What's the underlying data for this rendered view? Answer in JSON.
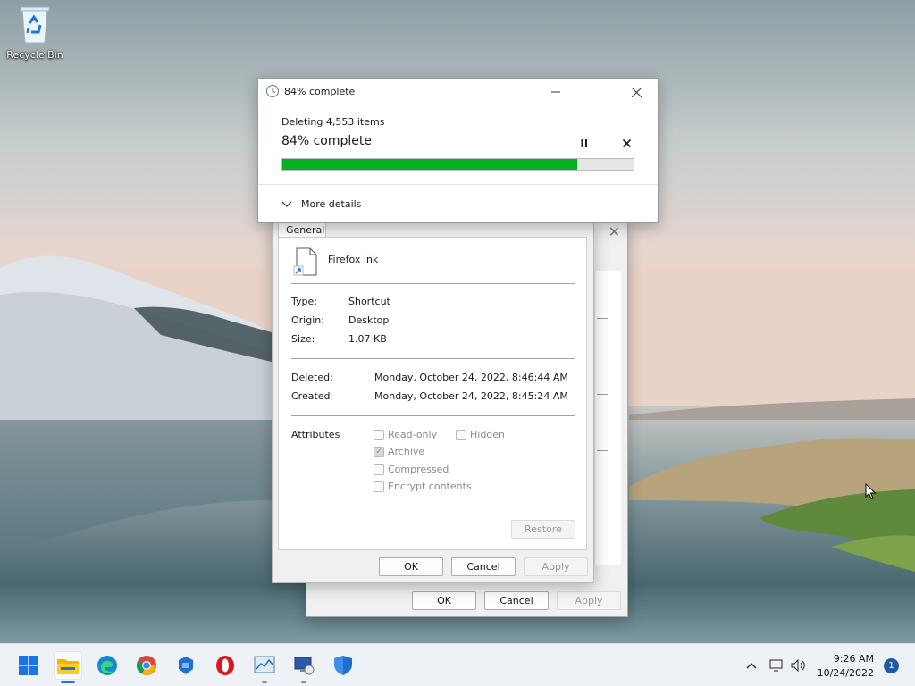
{
  "desktop": {
    "recycle_bin_label": "Recycle Bin"
  },
  "progress_dialog": {
    "title": "84% complete",
    "operation": "Deleting 4,553 items",
    "status": "84% complete",
    "progress_percent": 84,
    "more_details_label": "More details",
    "progress_color": "#06b025"
  },
  "properties_dialog": {
    "tab_general": "General",
    "file_name": "Firefox lnk",
    "type_label": "Type:",
    "type_value": "Shortcut",
    "origin_label": "Origin:",
    "origin_value": "Desktop",
    "size_label": "Size:",
    "size_value": "1.07 KB",
    "deleted_label": "Deleted:",
    "deleted_value": "Monday, October 24, 2022, 8:46:44 AM",
    "created_label": "Created:",
    "created_value": "Monday, October 24, 2022, 8:45:24 AM",
    "attributes_label": "Attributes",
    "attr_readonly": "Read-only",
    "attr_hidden": "Hidden",
    "attr_archive": "Archive",
    "attr_compressed": "Compressed",
    "attr_encrypt": "Encrypt contents",
    "restore_label": "Restore",
    "ok_label": "OK",
    "cancel_label": "Cancel",
    "apply_label": "Apply"
  },
  "back_dialog": {
    "ok_label": "OK",
    "cancel_label": "Cancel",
    "apply_label": "Apply"
  },
  "taskbar": {
    "icons": [
      "windows-start-icon",
      "file-explorer-icon",
      "edge-icon",
      "chrome-icon",
      "azure-data-icon",
      "opera-icon",
      "resource-monitor-icon",
      "remote-desktop-icon",
      "defender-icon"
    ],
    "time": "9:26 AM",
    "date": "10/24/2022",
    "notification_count": "1"
  }
}
